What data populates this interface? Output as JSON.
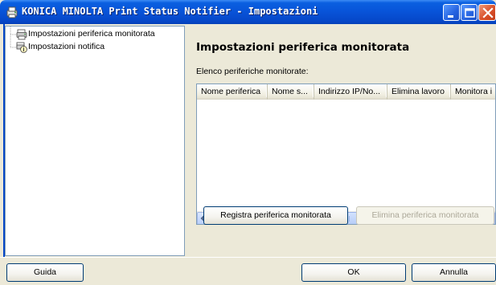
{
  "window": {
    "title": "KONICA MINOLTA Print Status Notifier - Impostazioni",
    "titlebar_color": "#0A5FE0",
    "close_color": "#D9502A"
  },
  "tree": {
    "items": [
      {
        "label": "Impostazioni periferica monitorata",
        "icon": "printer-icon"
      },
      {
        "label": "Impostazioni notifica",
        "icon": "notification-icon"
      }
    ]
  },
  "main": {
    "section_title": "Impostazioni periferica monitorata",
    "list_label": "Elenco periferiche monitorate:",
    "columns": [
      "Nome periferica",
      "Nome s...",
      "Indirizzo IP/No...",
      "Elimina lavoro",
      "Monitora i"
    ],
    "register_button": "Registra periferica monitorata",
    "delete_button": "Elimina periferica monitorata"
  },
  "footer": {
    "help_button": "Guida",
    "ok_button": "OK",
    "cancel_button": "Annulla"
  }
}
